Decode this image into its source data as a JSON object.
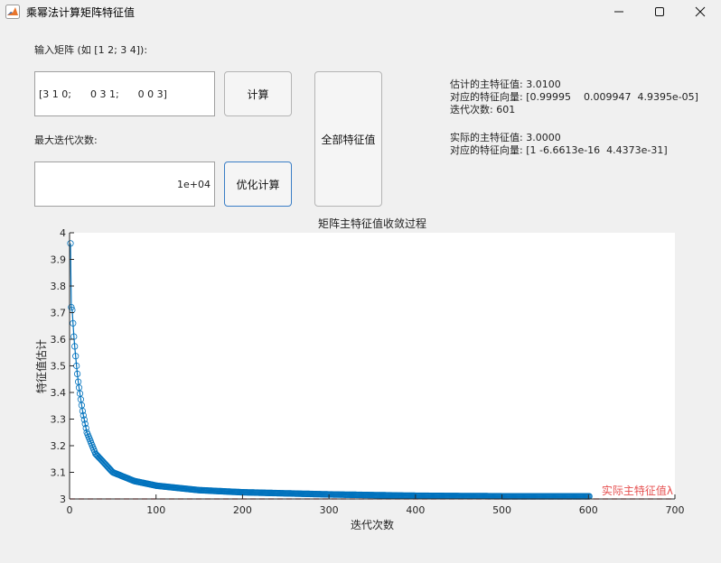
{
  "window": {
    "title": "乘幂法计算矩阵特征值"
  },
  "form": {
    "matrix_label": "输入矩阵 (如 [1 2; 3 4]):",
    "matrix_value": "[3 1 0;      0 3 1;      0 0 3]",
    "maxiter_label": "最大迭代次数:",
    "maxiter_value": "1e+04",
    "compute_label": "计算",
    "optimize_label": "优化计算",
    "all_eigen_label": "全部特征值"
  },
  "results": {
    "est_value": "估计的主特征值: 3.0100",
    "est_vector": "对应的特征向量: [0.99995    0.009947  4.9395e-05]",
    "iterations": "迭代次数: 601",
    "actual_value": "实际的主特征值: 3.0000",
    "actual_vector": "对应的特征向量: [1 -6.6613e-16  4.4373e-31]"
  },
  "chart_data": {
    "type": "line",
    "title": "矩阵主特征值收敛过程",
    "xlabel": "迭代次数",
    "ylabel": "特征值估计",
    "xlim": [
      0,
      700
    ],
    "ylim": [
      3,
      4
    ],
    "xticks": [
      0,
      100,
      200,
      300,
      400,
      500,
      600,
      700
    ],
    "yticks": [
      3,
      3.1,
      3.2,
      3.3,
      3.4,
      3.5,
      3.6,
      3.7,
      3.8,
      3.9,
      4
    ],
    "series": [
      {
        "marker": "circle",
        "color": "#0072bd",
        "x_start": 1,
        "x_end": 601,
        "y_start": 3.96,
        "y_end": 3.01,
        "sample_points": [
          [
            1,
            3.96
          ],
          [
            2,
            3.72
          ],
          [
            3,
            3.71
          ],
          [
            5,
            3.61
          ],
          [
            8,
            3.5
          ],
          [
            10,
            3.44
          ],
          [
            15,
            3.33
          ],
          [
            20,
            3.25
          ],
          [
            30,
            3.17
          ],
          [
            50,
            3.1
          ],
          [
            75,
            3.067
          ],
          [
            100,
            3.05
          ],
          [
            150,
            3.033
          ],
          [
            200,
            3.025
          ],
          [
            300,
            3.017
          ],
          [
            400,
            3.012
          ],
          [
            500,
            3.01
          ],
          [
            601,
            3.01
          ]
        ]
      }
    ],
    "reference_line": {
      "y": 3,
      "label": "实际主特征值λ",
      "color": "#e65050",
      "style": "dashed"
    }
  },
  "colors": {
    "series": "#0072bd",
    "reference": "#e65050",
    "focus_border": "#3a7ec6"
  }
}
